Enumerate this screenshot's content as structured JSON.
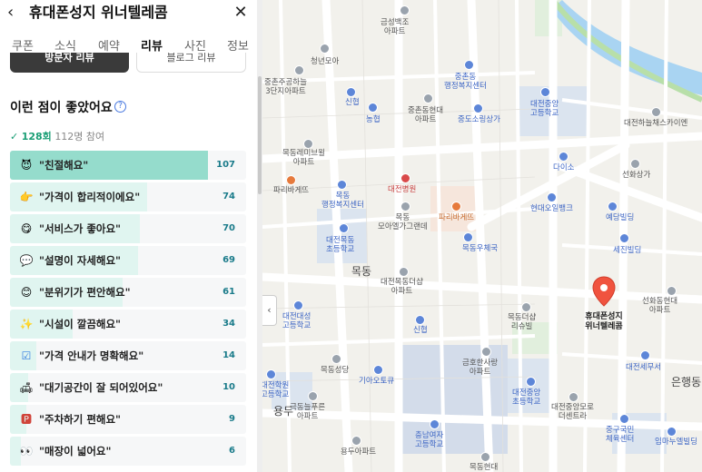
{
  "header": {
    "title": "휴대폰성지 위너텔레콤",
    "back_icon": "chevron-left-icon",
    "close_icon": "close-icon"
  },
  "tabs": [
    {
      "label": "쿠폰",
      "active": false
    },
    {
      "label": "소식",
      "active": false
    },
    {
      "label": "예약",
      "active": false
    },
    {
      "label": "리뷰",
      "active": true
    },
    {
      "label": "사진",
      "active": false
    },
    {
      "label": "정보",
      "active": false
    }
  ],
  "subtabs": {
    "visitor": "방문자 리뷰",
    "blog": "블로그 리뷰"
  },
  "section": {
    "title": "이런 점이 좋았어요",
    "count_strong": "128회",
    "participants": "112명 참여"
  },
  "reviews": [
    {
      "icon": "😈",
      "label": "\"친절해요\"",
      "count": "107",
      "value": 107
    },
    {
      "icon": "👉",
      "label": "\"가격이 합리적이에요\"",
      "count": "74",
      "value": 74
    },
    {
      "icon": "😋",
      "label": "\"서비스가 좋아요\"",
      "count": "70",
      "value": 70
    },
    {
      "icon": "💬",
      "label": "\"설명이 자세해요\"",
      "count": "69",
      "value": 69
    },
    {
      "icon": "😊",
      "label": "\"분위기가 편안해요\"",
      "count": "61",
      "value": 61
    },
    {
      "icon": "✨",
      "label": "\"시설이 깔끔해요\"",
      "count": "34",
      "value": 34
    },
    {
      "icon": "☑",
      "label": "\"가격 안내가 명확해요\"",
      "count": "14",
      "value": 14
    },
    {
      "icon": "🛋",
      "label": "\"대기공간이 잘 되어있어요\"",
      "count": "10",
      "value": 10
    },
    {
      "icon": "🅿",
      "label": "\"주차하기 편해요\"",
      "count": "9",
      "value": 9
    },
    {
      "icon": "👀",
      "label": "\"매장이 넓어요\"",
      "count": "6",
      "value": 6
    }
  ],
  "map": {
    "labels": {
      "geumsung": "금성백조\n아파트",
      "cheongmin": "청년모아",
      "jungchon_apt": "중촌주공하늘\n3단지아파트",
      "jungchon_center": "중촌동\n행정복지센터",
      "sinhan": "신협",
      "nonghyup": "농협",
      "jungchon_hyundai": "중촌동현대\n아파트",
      "jungdo": "중도소링상가",
      "daejeon_jungang": "대전중앙\n고등학교",
      "daejeon_haneul": "대전하늘채스카이엔",
      "mokdong_brown": "목동레미브윌\n아파트",
      "paris1": "파리바게뜨",
      "daiso": "다이소",
      "seonhwa_sangga": "선화상가",
      "mokdong_center": "목동\n행정복지센터",
      "daejeon_hospital": "대전병원",
      "paris2": "파리바게뜨",
      "mokdong_moa": "목동\n모아엘가그랜데",
      "hana_bank": "현대오일뱅크",
      "yedang": "예당빌딩",
      "mokdong_elem": "대전목동\n초등학교",
      "mokdong_post": "목동우체국",
      "sejin": "세진빌딩",
      "mokdong": "목동",
      "mokdong_deoksan": "대전목동더샵\n아파트",
      "seonhwa_hyundai": "선화동현대\n아파트",
      "daesung_high": "대전대성\n고등학교",
      "mokdong_ipark": "목동더샵\n리슈빌",
      "sinhan2": "신협",
      "daejeon_tax": "대전세무서",
      "mokdong_cathedral": "목동성당",
      "geumho": "금호한사랑\n아파트",
      "gia": "기아오토큐",
      "daejeon_hakwon": "대전학원\n고등학교",
      "jungang_elem": "대전중앙\n초등학교",
      "yongdu_puru": "극동늘푸른\n아파트",
      "yongdu": "용두",
      "daejeon_moro": "대전중앙모로\n더센트라",
      "eunhaeng": "은행동",
      "junggu_gym": "중구국민\n체육센터",
      "sangdu_apt": "용두아파트",
      "chungnam_girls": "충남여자\n고등학교",
      "mokdong_hyundai": "목동현대",
      "imma": "임마누엘빌딩"
    },
    "marker_label": "휴대폰성지\n위너텔레콤"
  }
}
